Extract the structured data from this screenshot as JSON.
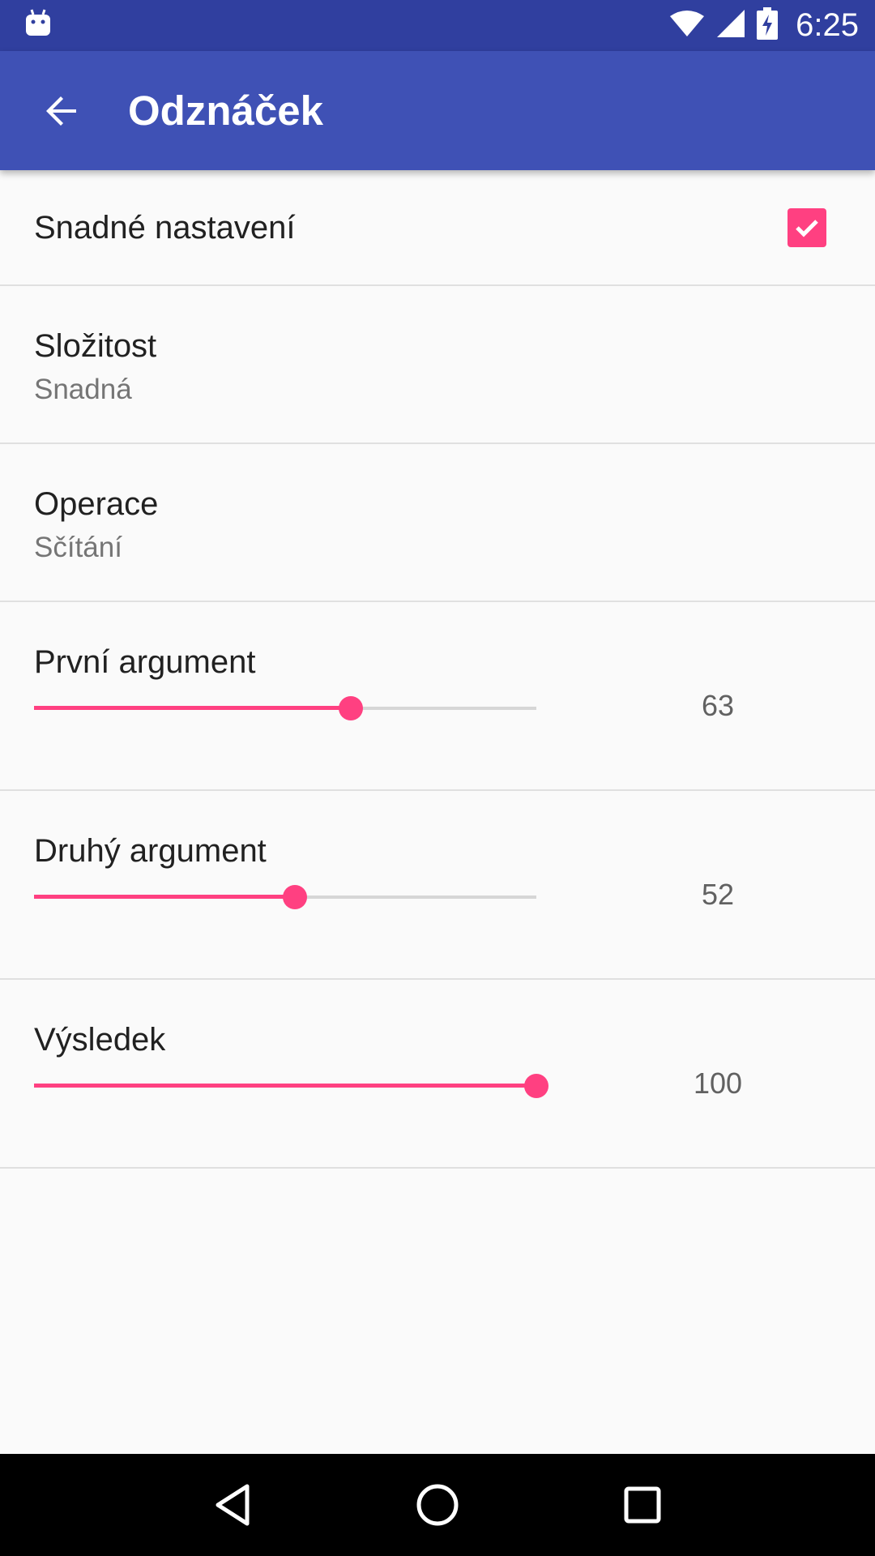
{
  "status_bar": {
    "time": "6:25",
    "icons": [
      "android-debug-icon",
      "wifi-icon",
      "signal-icon",
      "battery-charging-icon"
    ]
  },
  "app_bar": {
    "title": "Odznáček",
    "back_icon": "arrow-back-icon"
  },
  "settings": {
    "easy_setup": {
      "label": "Snadné nastavení",
      "checked": true
    },
    "complexity": {
      "label": "Složitost",
      "value": "Snadná"
    },
    "operation": {
      "label": "Operace",
      "value": "Sčítání"
    },
    "first_argument": {
      "label": "První argument",
      "value": "63",
      "fill_fraction": 0.63
    },
    "second_argument": {
      "label": "Druhý argument",
      "value": "52",
      "fill_fraction": 0.52
    },
    "result": {
      "label": "Výsledek",
      "value": "100",
      "fill_fraction": 1.0
    }
  },
  "colors": {
    "status_bar": "#303f9f",
    "app_bar": "#3f51b5",
    "accent": "#ff4081",
    "background": "#fafafa"
  },
  "nav_bar": {
    "icons": [
      "back-triangle-icon",
      "home-circle-icon",
      "recents-square-icon"
    ]
  }
}
